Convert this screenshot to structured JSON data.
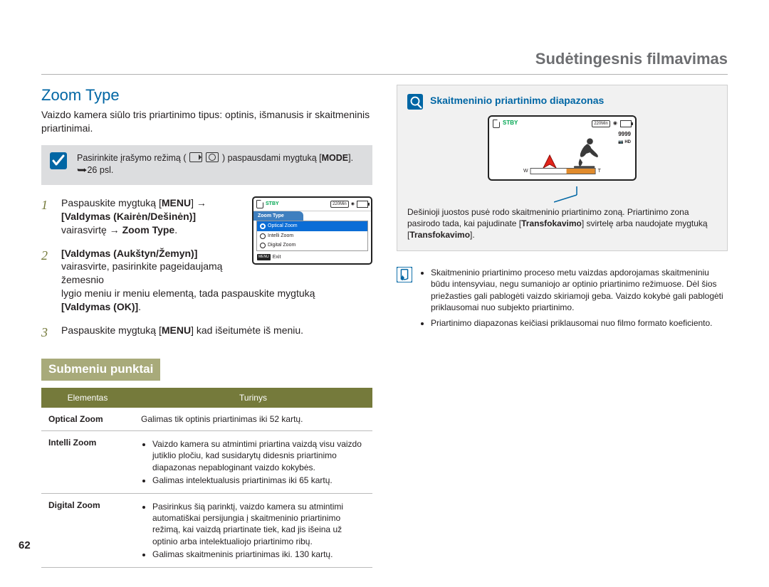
{
  "header": {
    "section": "Sudėtingesnis filmavimas"
  },
  "left": {
    "title": "Zoom Type",
    "intro": "Vaizdo kamera siūlo tris priartinimo tipus: optinis, išmanusis ir skaitmeninis priartinimai.",
    "info_pre": "Pasirinkite įrašymo režimą (",
    "info_post": ") paspausdami mygtuką",
    "info_mode": "MODE",
    "info_ref": "26 psl.",
    "step1": {
      "a": "Paspauskite mygtuką [",
      "menu": "MENU",
      "b": "] → ",
      "c": "[Valdymas (Kairėn/Dešinėn)]",
      "d": "vairasvirtę → ",
      "e": "Zoom Type"
    },
    "step2": {
      "a": "[Valdymas (Aukštyn/Žemyn)]",
      "b": "vairasvirte, pasirinkite pageidaujamą žemesnio",
      "c": "lygio meniu ir meniu elementą, tada paspauskite mygtuką",
      "d": "[Valdymas (OK)]"
    },
    "step3": {
      "a": "Paspauskite mygtuką [",
      "menu": "MENU",
      "b": "] kad išeitumėte iš meniu."
    },
    "osd": {
      "stby": "STBY",
      "time": "220Min",
      "tab": "Zoom Type",
      "items": [
        "Optical Zoom",
        "Intelli Zoom",
        "Digital Zoom"
      ],
      "exit": "Exit",
      "menu_badge": "MENU"
    },
    "sub_head": "Submeniu punktai",
    "table": {
      "col1": "Elementas",
      "col2": "Turinys",
      "rows": [
        {
          "name": "Optical Zoom",
          "text": "Galimas tik optinis priartinimas iki 52 kartų."
        },
        {
          "name": "Intelli Zoom",
          "bullets": [
            "Vaizdo kamera su atmintimi priartina vaizdą visu vaizdo jutiklio pločiu, kad susidarytų didesnis priartinimo diapazonas nepabloginant vaizdo kokybės.",
            "Galimas intelektualusis priartinimas iki 65 kartų."
          ]
        },
        {
          "name": "Digital Zoom",
          "bullets": [
            "Pasirinkus šią parinktį, vaizdo kamera su atmintimi automatiškai persijungia į skaitmeninio priartinimo režimą, kai vaizdą priartinate tiek, kad jis išeina už optinio arba intelektualiojo priartinimo ribų.",
            "Galimas skaitmeninis priartinimas iki. 130 kartų."
          ]
        }
      ]
    }
  },
  "right": {
    "box_title": "Skaitmeninio priartinimo diapazonas",
    "osd": {
      "stby": "STBY",
      "time": "220Min",
      "num": "9999",
      "hd": "HD",
      "w": "W",
      "t": "T"
    },
    "box_desc": "Dešinioji juostos pusė rodo skaitmeninio priartinimo zoną. Priartinimo zona pasirodo tada, kai pajudinate [Transfokavimo] svirtelę arba naudojate mygtuką [Transfokavimo].",
    "box_desc_bold1": "Transfokavimo",
    "box_desc_bold2": "Transfokavimo",
    "notes": [
      "Skaitmeninio priartinimo proceso metu vaizdas apdorojamas skaitmeniniu būdu intensyviau, negu sumaniojo ar optinio priartinimo režimuose. Dėl šios priežasties gali pablogėti vaizdo skiriamoji geba. Vaizdo kokybė gali pablogėti priklausomai nuo subjekto priartinimo.",
      "Priartinimo diapazonas keičiasi priklausomai nuo filmo formato koeficiento."
    ]
  },
  "page_number": "62"
}
